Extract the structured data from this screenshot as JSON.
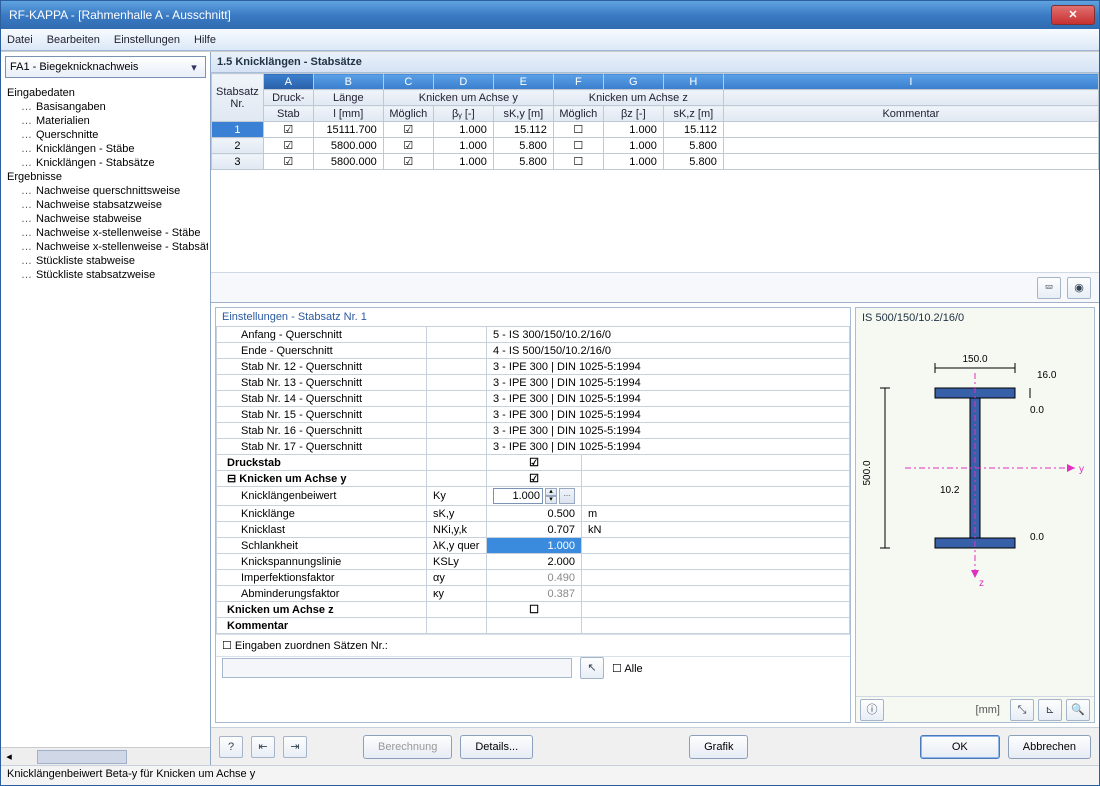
{
  "window": {
    "title": "RF-KAPPA - [Rahmenhalle A - Ausschnitt]"
  },
  "menu": {
    "file": "Datei",
    "edit": "Bearbeiten",
    "settings": "Einstellungen",
    "help": "Hilfe"
  },
  "dropdown": {
    "value": "FA1 - Biegeknicknachweis"
  },
  "tree": {
    "input": "Eingabedaten",
    "input_items": [
      "Basisangaben",
      "Materialien",
      "Querschnitte",
      "Knicklängen - Stäbe",
      "Knicklängen - Stabsätze"
    ],
    "results": "Ergebnisse",
    "result_items": [
      "Nachweise querschnittsweise",
      "Nachweise stabsatzweise",
      "Nachweise stabweise",
      "Nachweise x-stellenweise - Stäbe",
      "Nachweise x-stellenweise - Stabsätze",
      "Stückliste stabweise",
      "Stückliste stabsatzweise"
    ]
  },
  "section": {
    "title": "1.5 Knicklängen - Stabsätze"
  },
  "grid": {
    "letters": [
      "A",
      "B",
      "C",
      "D",
      "E",
      "F",
      "G",
      "H",
      "I"
    ],
    "h1": {
      "c0": "Stabsatz",
      "c1": "Druck-",
      "c2": "Länge",
      "g1": "Knicken um Achse y",
      "g2": "Knicken um Achse z",
      "c9": ""
    },
    "h2": {
      "c0": "Nr.",
      "c1": "Stab",
      "c2": "l [mm]",
      "c3": "Möglich",
      "c4": "βᵧ [-]",
      "c5": "sK,y [m]",
      "c6": "Möglich",
      "c7": "βᴢ [-]",
      "c8": "sK,z [m]",
      "c9": "Kommentar"
    },
    "rows": [
      {
        "nr": "1",
        "druck": true,
        "l": "15111.700",
        "my": true,
        "by": "1.000",
        "sky": "15.112",
        "mz": false,
        "bz": "1.000",
        "skz": "15.112",
        "kom": ""
      },
      {
        "nr": "2",
        "druck": true,
        "l": "5800.000",
        "my": true,
        "by": "1.000",
        "sky": "5.800",
        "mz": false,
        "bz": "1.000",
        "skz": "5.800",
        "kom": ""
      },
      {
        "nr": "3",
        "druck": true,
        "l": "5800.000",
        "my": true,
        "by": "1.000",
        "sky": "5.800",
        "mz": false,
        "bz": "1.000",
        "skz": "5.800",
        "kom": ""
      }
    ]
  },
  "details": {
    "title": "Einstellungen  -  Stabsatz Nr. 1",
    "rows": [
      {
        "l": "Anfang - Querschnitt",
        "v": "5 - IS 300/150/10.2/16/0"
      },
      {
        "l": "Ende - Querschnitt",
        "v": "4 - IS 500/150/10.2/16/0"
      },
      {
        "l": "Stab Nr. 12 - Querschnitt",
        "v": "3 - IPE 300 | DIN 1025-5:1994"
      },
      {
        "l": "Stab Nr. 13 - Querschnitt",
        "v": "3 - IPE 300 | DIN 1025-5:1994"
      },
      {
        "l": "Stab Nr. 14 - Querschnitt",
        "v": "3 - IPE 300 | DIN 1025-5:1994"
      },
      {
        "l": "Stab Nr. 15 - Querschnitt",
        "v": "3 - IPE 300 | DIN 1025-5:1994"
      },
      {
        "l": "Stab Nr. 16 - Querschnitt",
        "v": "3 - IPE 300 | DIN 1025-5:1994"
      },
      {
        "l": "Stab Nr. 17 - Querschnitt",
        "v": "3 - IPE 300 | DIN 1025-5:1994"
      }
    ],
    "druckstab": "Druckstab",
    "kay_header": "Knicken um Achse y",
    "ky": {
      "l": "Knicklängenbeiwert",
      "s": "Ky",
      "v": "1.000"
    },
    "skl": {
      "l": "Knicklänge",
      "s": "sK,y",
      "v": "0.500",
      "u": "m"
    },
    "nkl": {
      "l": "Knicklast",
      "s": "NKi,y,k",
      "v": "0.707",
      "u": "kN"
    },
    "slk": {
      "l": "Schlankheit",
      "s": "λK,y quer",
      "v": "1.000"
    },
    "ksl": {
      "l": "Knickspannungslinie",
      "s": "KSLy",
      "v": "2.000"
    },
    "imp": {
      "l": "Imperfektionsfaktor",
      "s": "αy",
      "v": "0.490"
    },
    "abm": {
      "l": "Abminderungsfaktor",
      "s": "κy",
      "v": "0.387"
    },
    "kaz_header": "Knicken um Achse z",
    "kom": "Kommentar",
    "assign": "Eingaben zuordnen Sätzen Nr.:",
    "alle": "Alle"
  },
  "preview": {
    "title": "IS 500/150/10.2/16/0",
    "dims": {
      "w": "150.0",
      "tf": "16.0",
      "h": "500.0",
      "tw": "10.2",
      "zero": "0.0"
    },
    "unit": "[mm]"
  },
  "buttons": {
    "calc": "Berechnung",
    "det": "Details...",
    "graf": "Grafik",
    "ok": "OK",
    "cancel": "Abbrechen"
  },
  "status": "Knicklängenbeiwert Beta-y für Knicken um Achse y",
  "chart_data": {
    "type": "table",
    "title": "1.5 Knicklängen - Stabsätze",
    "columns": [
      "Stabsatz Nr.",
      "Druck-Stab",
      "Länge l [mm]",
      "Möglich(y)",
      "βy [-]",
      "sK,y [m]",
      "Möglich(z)",
      "βz [-]",
      "sK,z [m]",
      "Kommentar"
    ],
    "rows": [
      [
        1,
        true,
        15111.7,
        true,
        1.0,
        15.112,
        false,
        1.0,
        15.112,
        ""
      ],
      [
        2,
        true,
        5800.0,
        true,
        1.0,
        5.8,
        false,
        1.0,
        5.8,
        ""
      ],
      [
        3,
        true,
        5800.0,
        true,
        1.0,
        5.8,
        false,
        1.0,
        5.8,
        ""
      ]
    ]
  }
}
